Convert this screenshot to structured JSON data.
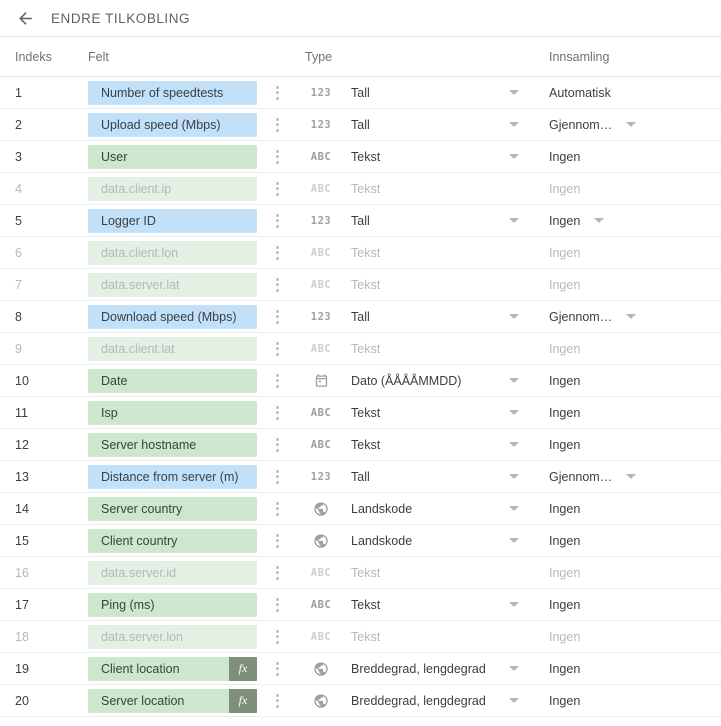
{
  "appbar": {
    "back_icon": "arrow-left-icon",
    "title": "ENDRE TILKOBLING"
  },
  "table": {
    "headers": {
      "index": "Indeks",
      "field": "Felt",
      "type": "Type",
      "collection": "Innsamling"
    },
    "rows": [
      {
        "index": "1",
        "field": "Number of speedtests",
        "chip": "blue",
        "fx": false,
        "type_icon": "number-123-icon",
        "type_glyph": "123",
        "type": "Tall",
        "type_caret": true,
        "collection": "Automatisk",
        "coll_caret": false,
        "disabled": false
      },
      {
        "index": "2",
        "field": "Upload speed (Mbps)",
        "chip": "blue",
        "fx": false,
        "type_icon": "number-123-icon",
        "type_glyph": "123",
        "type": "Tall",
        "type_caret": true,
        "collection": "Gjennom…",
        "coll_caret": true,
        "disabled": false
      },
      {
        "index": "3",
        "field": "User",
        "chip": "green",
        "fx": false,
        "type_icon": "text-abc-icon",
        "type_glyph": "ABC",
        "type": "Tekst",
        "type_caret": true,
        "collection": "Ingen",
        "coll_caret": false,
        "disabled": false
      },
      {
        "index": "4",
        "field": "data.client.ip",
        "chip": "green",
        "fx": false,
        "type_icon": "text-abc-icon",
        "type_glyph": "ABC",
        "type": "Tekst",
        "type_caret": false,
        "collection": "Ingen",
        "coll_caret": false,
        "disabled": true
      },
      {
        "index": "5",
        "field": "Logger ID",
        "chip": "blue",
        "fx": false,
        "type_icon": "number-123-icon",
        "type_glyph": "123",
        "type": "Tall",
        "type_caret": true,
        "collection": "Ingen",
        "coll_caret": true,
        "disabled": false
      },
      {
        "index": "6",
        "field": "data.client.lon",
        "chip": "green",
        "fx": false,
        "type_icon": "text-abc-icon",
        "type_glyph": "ABC",
        "type": "Tekst",
        "type_caret": false,
        "collection": "Ingen",
        "coll_caret": false,
        "disabled": true
      },
      {
        "index": "7",
        "field": "data.server.lat",
        "chip": "green",
        "fx": false,
        "type_icon": "text-abc-icon",
        "type_glyph": "ABC",
        "type": "Tekst",
        "type_caret": false,
        "collection": "Ingen",
        "coll_caret": false,
        "disabled": true
      },
      {
        "index": "8",
        "field": "Download speed (Mbps)",
        "chip": "blue",
        "fx": false,
        "type_icon": "number-123-icon",
        "type_glyph": "123",
        "type": "Tall",
        "type_caret": true,
        "collection": "Gjennom…",
        "coll_caret": true,
        "disabled": false
      },
      {
        "index": "9",
        "field": "data.client.lat",
        "chip": "green",
        "fx": false,
        "type_icon": "text-abc-icon",
        "type_glyph": "ABC",
        "type": "Tekst",
        "type_caret": false,
        "collection": "Ingen",
        "coll_caret": false,
        "disabled": true
      },
      {
        "index": "10",
        "field": "Date",
        "chip": "green",
        "fx": false,
        "type_icon": "calendar-icon",
        "type_glyph": "",
        "type": "Dato (ÅÅÅÅMMDD)",
        "type_caret": true,
        "collection": "Ingen",
        "coll_caret": false,
        "disabled": false
      },
      {
        "index": "11",
        "field": "Isp",
        "chip": "green",
        "fx": false,
        "type_icon": "text-abc-icon",
        "type_glyph": "ABC",
        "type": "Tekst",
        "type_caret": true,
        "collection": "Ingen",
        "coll_caret": false,
        "disabled": false
      },
      {
        "index": "12",
        "field": "Server hostname",
        "chip": "green",
        "fx": false,
        "type_icon": "text-abc-icon",
        "type_glyph": "ABC",
        "type": "Tekst",
        "type_caret": true,
        "collection": "Ingen",
        "coll_caret": false,
        "disabled": false
      },
      {
        "index": "13",
        "field": "Distance from server (m)",
        "chip": "blue",
        "fx": false,
        "type_icon": "number-123-icon",
        "type_glyph": "123",
        "type": "Tall",
        "type_caret": true,
        "collection": "Gjennom…",
        "coll_caret": true,
        "disabled": false
      },
      {
        "index": "14",
        "field": "Server country",
        "chip": "green",
        "fx": false,
        "type_icon": "globe-icon",
        "type_glyph": "",
        "type": "Landskode",
        "type_caret": true,
        "collection": "Ingen",
        "coll_caret": false,
        "disabled": false
      },
      {
        "index": "15",
        "field": "Client country",
        "chip": "green",
        "fx": false,
        "type_icon": "globe-icon",
        "type_glyph": "",
        "type": "Landskode",
        "type_caret": true,
        "collection": "Ingen",
        "coll_caret": false,
        "disabled": false
      },
      {
        "index": "16",
        "field": "data.server.id",
        "chip": "green",
        "fx": false,
        "type_icon": "text-abc-icon",
        "type_glyph": "ABC",
        "type": "Tekst",
        "type_caret": false,
        "collection": "Ingen",
        "coll_caret": false,
        "disabled": true
      },
      {
        "index": "17",
        "field": "Ping (ms)",
        "chip": "green",
        "fx": false,
        "type_icon": "text-abc-icon",
        "type_glyph": "ABC",
        "type": "Tekst",
        "type_caret": true,
        "collection": "Ingen",
        "coll_caret": false,
        "disabled": false
      },
      {
        "index": "18",
        "field": "data.server.lon",
        "chip": "green",
        "fx": false,
        "type_icon": "text-abc-icon",
        "type_glyph": "ABC",
        "type": "Tekst",
        "type_caret": false,
        "collection": "Ingen",
        "coll_caret": false,
        "disabled": true
      },
      {
        "index": "19",
        "field": "Client location",
        "chip": "green",
        "fx": true,
        "fx_label": "fx",
        "type_icon": "globe-icon",
        "type_glyph": "",
        "type": "Breddegrad, lengdegrad",
        "type_caret": true,
        "collection": "Ingen",
        "coll_caret": false,
        "disabled": false
      },
      {
        "index": "20",
        "field": "Server location",
        "chip": "green",
        "fx": true,
        "fx_label": "fx",
        "type_icon": "globe-icon",
        "type_glyph": "",
        "type": "Breddegrad, lengdegrad",
        "type_caret": true,
        "collection": "Ingen",
        "coll_caret": false,
        "disabled": false
      }
    ]
  },
  "colors": {
    "chip_blue": "#c2e0f7",
    "chip_green": "#cce7cc",
    "fx_badge": "#7e9079",
    "text": "#3c4043",
    "muted": "#b4b8b9"
  }
}
